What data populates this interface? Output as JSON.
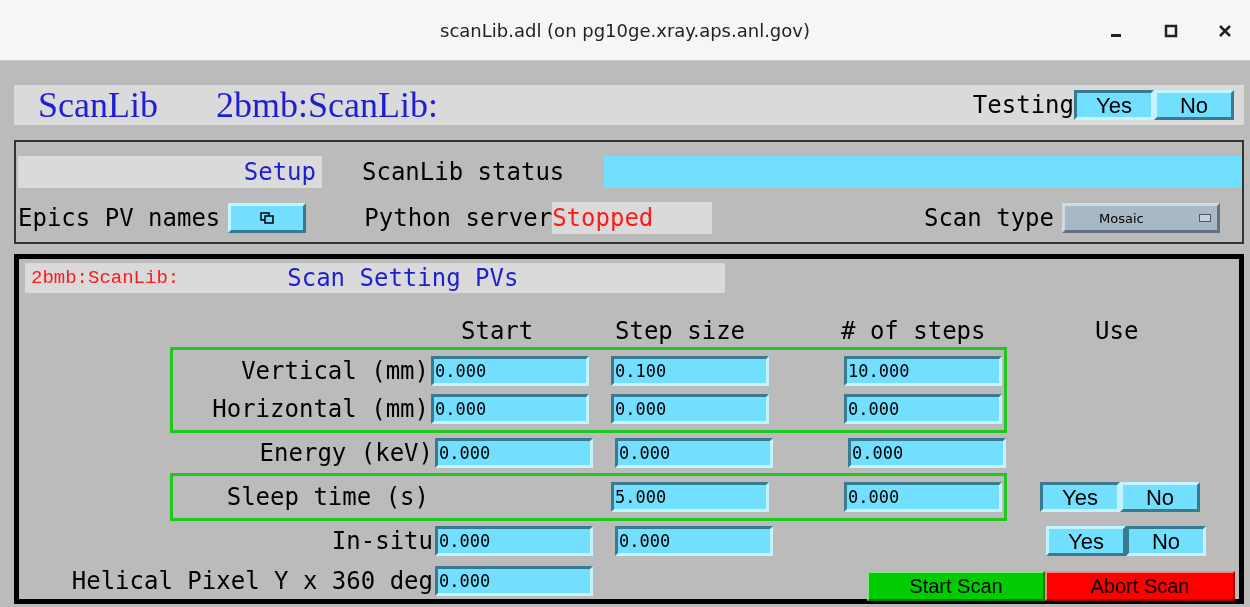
{
  "window": {
    "title": "scanLib.adl (on pg10ge.xray.aps.anl.gov)"
  },
  "header": {
    "title": "ScanLib",
    "prefix": "2bmb:ScanLib:",
    "testing": {
      "label": "Testing",
      "options": [
        {
          "label": "Yes",
          "selected": true
        },
        {
          "label": "No",
          "selected": false
        }
      ]
    }
  },
  "setup": {
    "title": "Setup",
    "status_label": "ScanLib status",
    "pv_names_label": "Epics PV names",
    "server_label": "Python server",
    "server_state": "Stopped",
    "scan_type_label": "Scan type",
    "scan_type": "Mosaic"
  },
  "scan_settings": {
    "prefix": "2bmb:ScanLib:",
    "title": "Scan Setting PVs",
    "columns": [
      "Start",
      "Step size",
      "# of steps",
      "Use"
    ],
    "sections": [
      {
        "outlined": true,
        "rows": [
          {
            "label": "Vertical (mm)",
            "start": "0.000",
            "step": "0.100",
            "steps": "10.000"
          },
          {
            "label": "Horizontal (mm)",
            "start": "0.000",
            "step": "0.000",
            "steps": "0.000"
          }
        ]
      },
      {
        "outlined": false,
        "rows": [
          {
            "label": "Energy (keV)",
            "start": "0.000",
            "step": "0.000",
            "steps": "0.000"
          }
        ]
      },
      {
        "outlined": true,
        "rows": [
          {
            "label": "Sleep time (s)",
            "step": "5.000",
            "steps": "0.000",
            "use": [
              {
                "label": "Yes",
                "selected": true
              },
              {
                "label": "No",
                "selected": false
              }
            ]
          }
        ]
      },
      {
        "outlined": false,
        "rows": [
          {
            "label": "In-situ",
            "start": "0.000",
            "step": "0.000",
            "use": [
              {
                "label": "Yes",
                "selected": false
              },
              {
                "label": "No",
                "selected": true
              }
            ]
          },
          {
            "label": "Helical Pixel Y x 360 deg",
            "start": "0.000"
          }
        ]
      }
    ],
    "actions": [
      {
        "label": "Start Scan",
        "kind": "start"
      },
      {
        "label": "Abort Scan",
        "kind": "abort"
      }
    ]
  }
}
